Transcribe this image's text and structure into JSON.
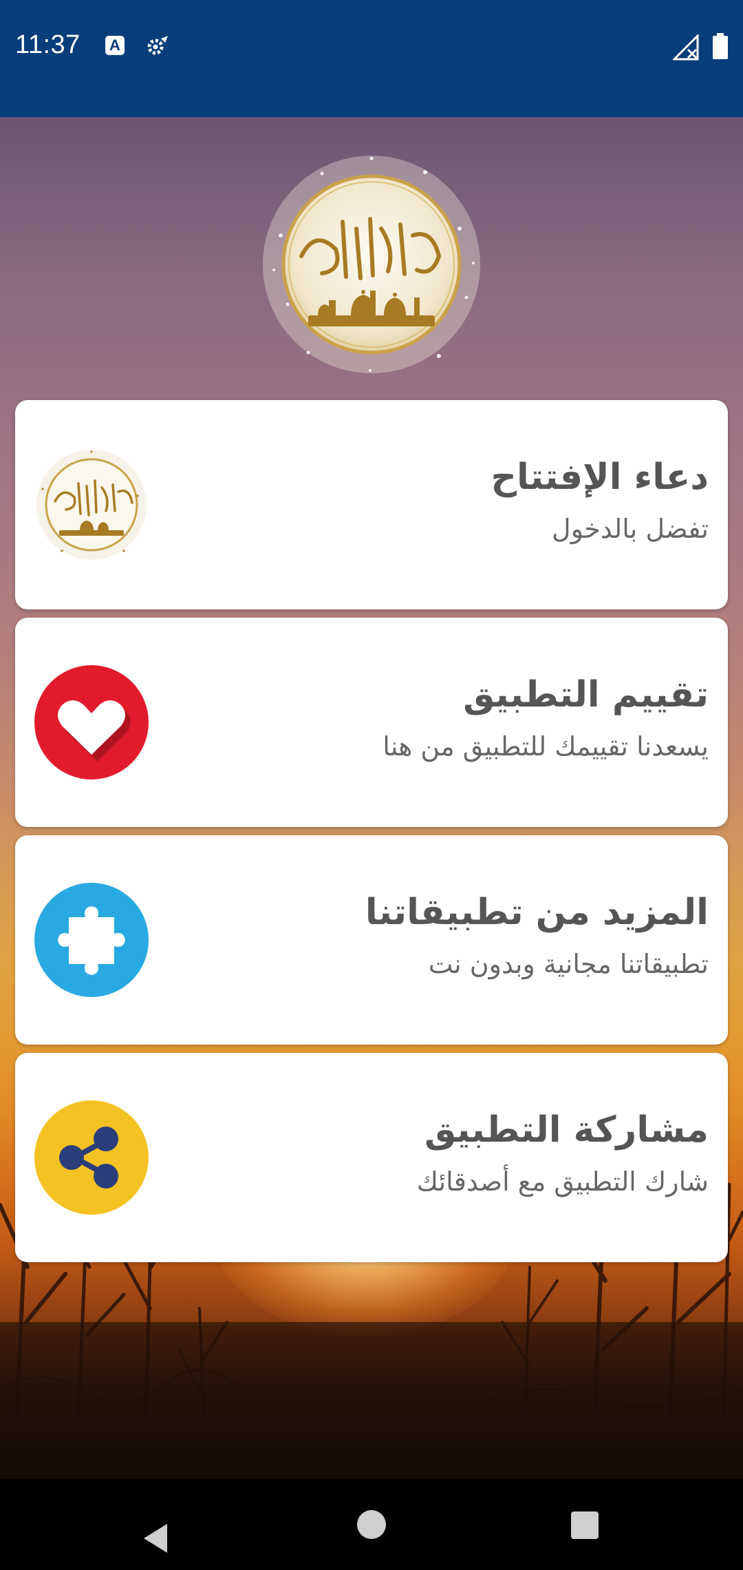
{
  "status_bar": {
    "time": "11:37",
    "a_badge": "A",
    "icons": [
      "a-notification-icon",
      "settings-icon",
      "no-signal-icon",
      "battery-icon"
    ]
  },
  "header": {
    "emblem_icon": "dua-al-iftitah-emblem"
  },
  "cards": [
    {
      "title": "دعاء الإفتتاح",
      "subtitle": "تفضل بالدخول",
      "icon": "dua-emblem-icon"
    },
    {
      "title": "تقييم التطبيق",
      "subtitle": "يسعدنا تقييمك للتطبيق من هنا",
      "icon": "heart-icon",
      "icon_color": "#e0212e"
    },
    {
      "title": "المزيد من تطبيقاتنا",
      "subtitle": "تطبيقاتنا مجانية وبدون نت",
      "icon": "puzzle-icon",
      "icon_color": "#29a9e1"
    },
    {
      "title": "مشاركة التطبيق",
      "subtitle": "شارك التطبيق مع أصدقائك",
      "icon": "share-icon",
      "icon_color": "#f4c223"
    }
  ],
  "nav_bar": {
    "icons": [
      "back-icon",
      "home-icon",
      "recents-icon"
    ]
  },
  "colors": {
    "status_bar": "#063d7a",
    "card_bg": "#ffffff",
    "title_text": "#555555"
  }
}
